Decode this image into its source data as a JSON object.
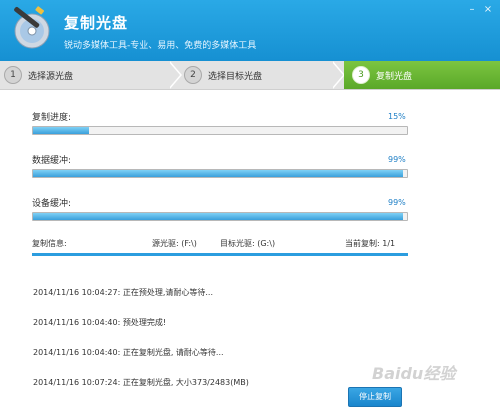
{
  "header": {
    "title": "复制光盘",
    "subtitle": "锐动多媒体工具-专业、易用、免费的多媒体工具",
    "logo_icon": "disc-wand-icon",
    "minimize_glyph": "–",
    "close_glyph": "×"
  },
  "steps": [
    {
      "num": "1",
      "label": "选择源光盘"
    },
    {
      "num": "2",
      "label": "选择目标光盘"
    },
    {
      "num": "3",
      "label": "复制光盘"
    }
  ],
  "progress": [
    {
      "label": "复制进度:",
      "percent_text": "15%",
      "value": 15
    },
    {
      "label": "数据缓冲:",
      "percent_text": "99%",
      "value": 99
    },
    {
      "label": "设备缓冲:",
      "percent_text": "99%",
      "value": 99
    }
  ],
  "info": {
    "label": "复制信息:",
    "source": "源光驱: (F:\\)",
    "target": "目标光驱: (G:\\)",
    "current": "当前复制: 1/1"
  },
  "log": [
    "2014/11/16 10:04:27: 正在预处理,请耐心等待...",
    "2014/11/16 10:04:40: 预处理完成!",
    "2014/11/16 10:04:40: 正在复制光盘, 请耐心等待...",
    "2014/11/16 10:07:24: 正在复制光盘, 大小373/2483(MB)"
  ],
  "buttons": {
    "stop": "停止复制"
  },
  "watermark": "Baidu经验",
  "colors": {
    "header_blue": "#1e9adf",
    "step_active_green": "#6ab735",
    "progress_fill": "#3a9fdb"
  }
}
